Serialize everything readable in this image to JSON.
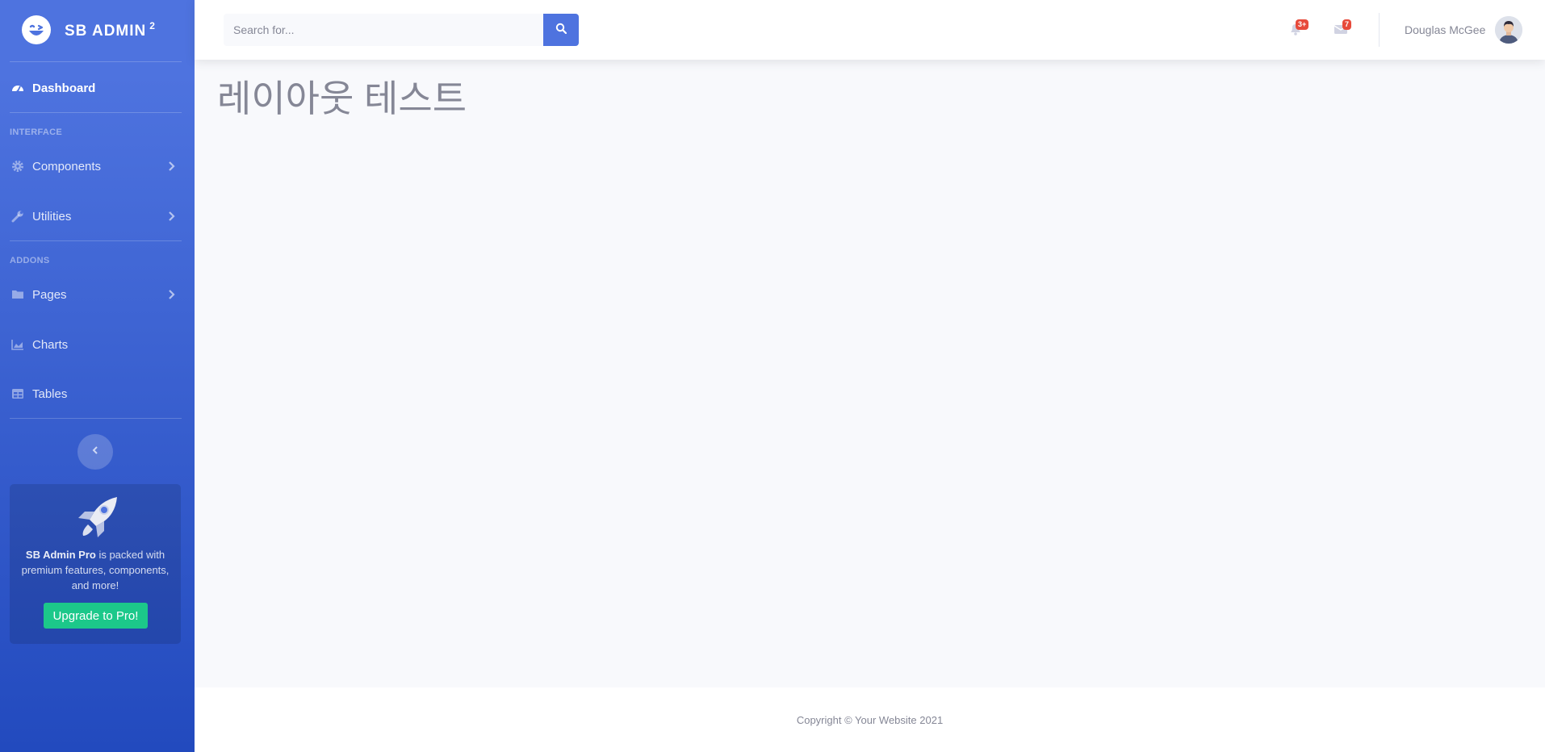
{
  "sidebar": {
    "brand": {
      "name": "SB ADMIN",
      "sup": "2",
      "icon": "laugh-wink-icon"
    },
    "dashboard": {
      "label": "Dashboard",
      "icon": "tachometer-icon"
    },
    "headings": {
      "interface": "INTERFACE",
      "addons": "ADDONS"
    },
    "items": [
      {
        "label": "Components",
        "icon": "cog-icon"
      },
      {
        "label": "Utilities",
        "icon": "wrench-icon"
      },
      {
        "label": "Pages",
        "icon": "folder-icon"
      },
      {
        "label": "Charts",
        "icon": "chart-area-icon"
      },
      {
        "label": "Tables",
        "icon": "table-icon"
      }
    ],
    "promo": {
      "bold": "SB Admin Pro",
      "text": " is packed with premium features, components, and more!",
      "button": "Upgrade to Pro!"
    }
  },
  "topbar": {
    "search": {
      "placeholder": "Search for..."
    },
    "alerts": {
      "badge": "3+"
    },
    "messages": {
      "badge": "7"
    },
    "user": {
      "name": "Douglas McGee"
    }
  },
  "main": {
    "title": "레이아웃 테스트"
  },
  "footer": {
    "copyright": "Copyright © Your Website 2021"
  },
  "colors": {
    "primary": "#4e73df",
    "primary_dark": "#224abe",
    "success": "#1cc88a",
    "danger": "#e74a3b",
    "text": "#858796"
  }
}
